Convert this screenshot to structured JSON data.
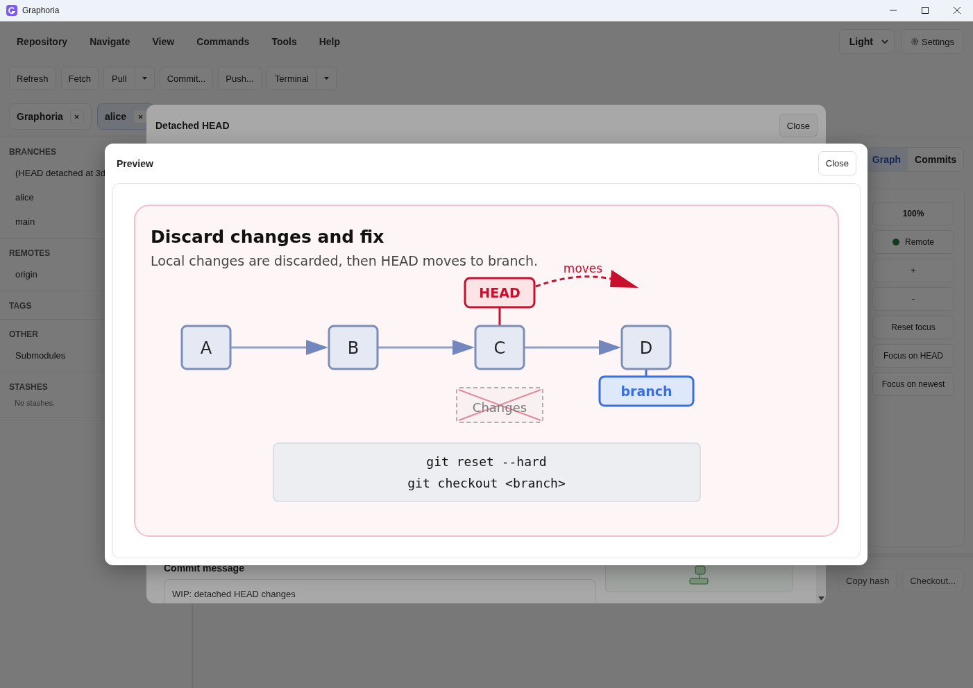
{
  "window": {
    "title": "Graphoria"
  },
  "menu": [
    "Repository",
    "Navigate",
    "View",
    "Commands",
    "Tools",
    "Help"
  ],
  "theme_select": {
    "value": "Light"
  },
  "settings_button": {
    "label": "Settings"
  },
  "toolbar": [
    {
      "label": "Refresh",
      "kind": "button"
    },
    {
      "label": "Fetch",
      "kind": "button"
    },
    {
      "label": "Pull",
      "kind": "split"
    },
    {
      "label": "Commit...",
      "kind": "button"
    },
    {
      "label": "Push...",
      "kind": "button"
    },
    {
      "label": "Terminal",
      "kind": "split"
    }
  ],
  "repo_tabs": [
    {
      "label": "Graphoria",
      "selected": false
    },
    {
      "label": "alice",
      "selected": true
    }
  ],
  "sidebar": [
    {
      "title": "BRANCHES",
      "items": [
        "(HEAD detached at 3d",
        "alice",
        "main"
      ]
    },
    {
      "title": "REMOTES",
      "items": [
        "origin"
      ]
    },
    {
      "title": "TAGS"
    },
    {
      "title": "OTHER",
      "items": [
        "Submodules"
      ]
    },
    {
      "title": "STASHES",
      "note": "No stashes."
    }
  ],
  "view_tabs": [
    {
      "label": "Graph",
      "selected": true
    },
    {
      "label": "Commits",
      "selected": false
    }
  ],
  "graph_controls": [
    {
      "label": "100%",
      "kind": "readout"
    },
    {
      "label": "Remote",
      "kind": "toggle",
      "on": true
    },
    {
      "label": "+",
      "kind": "button"
    },
    {
      "label": "-",
      "kind": "button"
    },
    {
      "label": "Reset focus",
      "kind": "button"
    },
    {
      "label": "Focus on HEAD",
      "kind": "button"
    },
    {
      "label": "Focus on newest",
      "kind": "button"
    }
  ],
  "detail_actions": [
    "Copy hash",
    "Checkout..."
  ],
  "detached_dialog": {
    "title": "Detached HEAD",
    "close": "Close",
    "commit_message": {
      "label": "Commit message",
      "value": "WIP: detached HEAD changes"
    }
  },
  "preview_dialog": {
    "title": "Preview",
    "close": "Close",
    "card": {
      "title": "Discard changes and fix",
      "subtitle": "Local changes are discarded, then HEAD moves to branch.",
      "diagram": {
        "commits": [
          "A",
          "B",
          "C",
          "D"
        ],
        "head": "HEAD",
        "branch": "branch",
        "move_label": "moves",
        "discarded": "Changes"
      },
      "commands": [
        "git reset --hard",
        "git checkout <branch>"
      ]
    }
  }
}
